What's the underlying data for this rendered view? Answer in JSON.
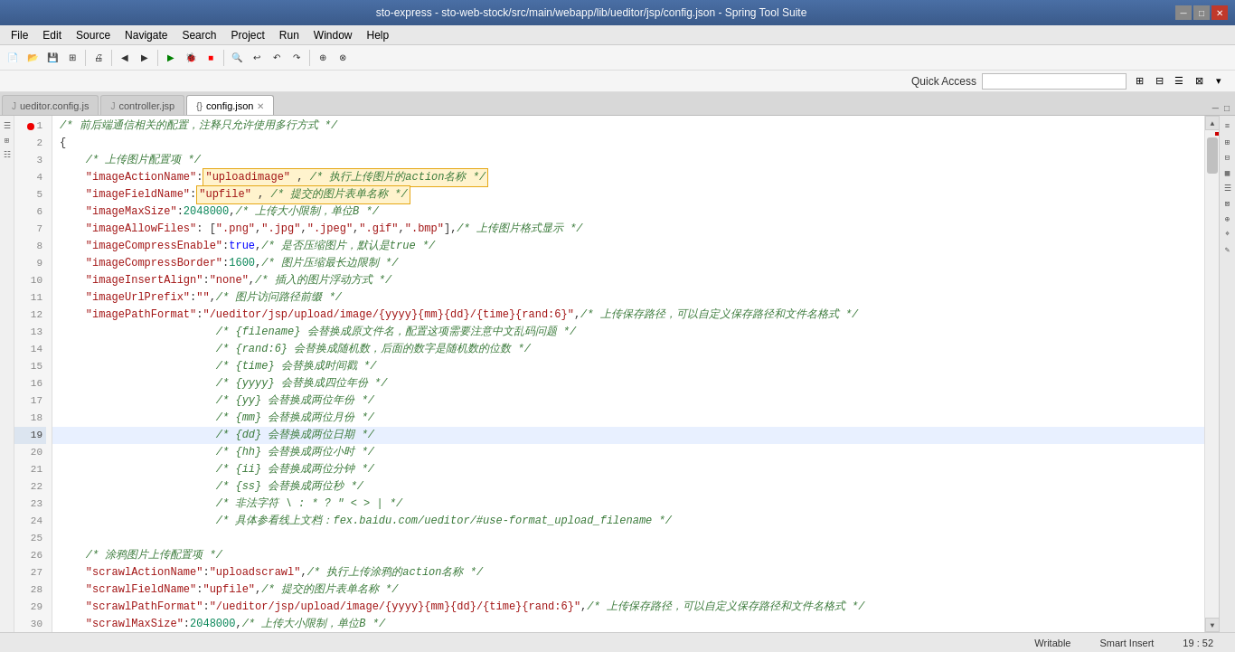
{
  "titleBar": {
    "title": "sto-express - sto-web-stock/src/main/webapp/lib/ueditor/jsp/config.json - Spring Tool Suite",
    "minimizeBtn": "─",
    "maximizeBtn": "□",
    "closeBtn": "✕"
  },
  "menuBar": {
    "items": [
      "File",
      "Edit",
      "Source",
      "Navigate",
      "Search",
      "Project",
      "Run",
      "Window",
      "Help"
    ]
  },
  "quickAccess": {
    "label": "Quick Access"
  },
  "tabs": [
    {
      "id": "tab1",
      "icon": "J",
      "label": "ueditor.config.js",
      "active": false,
      "closable": false
    },
    {
      "id": "tab2",
      "icon": "J",
      "label": "controller.jsp",
      "active": false,
      "closable": false
    },
    {
      "id": "tab3",
      "icon": "{}",
      "label": "config.json",
      "active": true,
      "closable": true
    }
  ],
  "codeLines": [
    {
      "num": 1,
      "hasError": true,
      "content": "/* 前后端通信相关的配置，注释只允许使用多行方式 */",
      "type": "comment",
      "highlighted": false
    },
    {
      "num": 2,
      "content": "{",
      "highlighted": false
    },
    {
      "num": 3,
      "content": "    /* 上传图片配置项 */",
      "type": "comment",
      "highlighted": false
    },
    {
      "num": 4,
      "content": "    \"imageActionName\": \"uploadimage\",  /* 执行上传图片的action名称 */",
      "highlighted": false,
      "hasHighlightBox": true,
      "boxStart": 22,
      "special": "line4"
    },
    {
      "num": 5,
      "content": "    \"imageFieldName\": \"upfile\",  /* 提交的图片表单名称 */",
      "highlighted": false,
      "special": "line5"
    },
    {
      "num": 6,
      "content": "    \"imageMaxSize\": 2048000,  /* 上传大小限制，单位B */",
      "highlighted": false
    },
    {
      "num": 7,
      "content": "    \"imageAllowFiles\": [\".png\", \".jpg\", \".jpeg\", \".gif\", \".bmp\"],  /* 上传图片格式显示 */",
      "highlighted": false
    },
    {
      "num": 8,
      "content": "    \"imageCompressEnable\": true,  /* 是否压缩图片，默认是true */",
      "highlighted": false
    },
    {
      "num": 9,
      "content": "    \"imageCompressBorder\": 1600,  /* 图片压缩最长边限制 */",
      "highlighted": false
    },
    {
      "num": 10,
      "content": "    \"imageInsertAlign\": \"none\",  /* 插入的图片浮动方式 */",
      "highlighted": false
    },
    {
      "num": 11,
      "content": "    \"imageUrlPrefix\": \"\",  /* 图片访问路径前缀 */",
      "highlighted": false
    },
    {
      "num": 12,
      "content": "    \"imagePathFormat\": \"/ueditor/jsp/upload/image/{yyyy}{mm}{dd}/{time}{rand:6}\",  /* 上传保存路径，可以自定义保存路径和文件名格式 */",
      "highlighted": false
    },
    {
      "num": 13,
      "content": "                        /* {filename} 会替换成原文件名，配置这项需要注意中文乱码问题 */",
      "type": "comment",
      "highlighted": false
    },
    {
      "num": 14,
      "content": "                        /* {rand:6} 会替换成随机数，后面的数字是随机数的位数 */",
      "type": "comment",
      "highlighted": false
    },
    {
      "num": 15,
      "content": "                        /* {time} 会替换成时间戳 */",
      "type": "comment",
      "highlighted": false
    },
    {
      "num": 16,
      "content": "                        /* {yyyy} 会替换成四位年份 */",
      "type": "comment",
      "highlighted": false
    },
    {
      "num": 17,
      "content": "                        /* {yy} 会替换成两位年份 */",
      "type": "comment",
      "highlighted": false
    },
    {
      "num": 18,
      "content": "                        /* {mm} 会替换成两位月份 */",
      "type": "comment",
      "highlighted": false
    },
    {
      "num": 19,
      "content": "                        /* {dd} 会替换成两位日期 */",
      "type": "comment",
      "highlighted": true
    },
    {
      "num": 20,
      "content": "                        /* {hh} 会替换成两位小时 */",
      "type": "comment",
      "highlighted": false
    },
    {
      "num": 21,
      "content": "                        /* {ii} 会替换成两位分钟 */",
      "type": "comment",
      "highlighted": false
    },
    {
      "num": 22,
      "content": "                        /* {ss} 会替换成两位秒 */",
      "type": "comment",
      "highlighted": false
    },
    {
      "num": 23,
      "content": "                        /* 非法字符 \\ : * ? \" < > | */",
      "type": "comment",
      "highlighted": false
    },
    {
      "num": 24,
      "content": "                        /* 具体参看线上文档：fex.baidu.com/ueditor/#use-format_upload_filename */",
      "type": "comment",
      "highlighted": false
    },
    {
      "num": 25,
      "content": "",
      "highlighted": false
    },
    {
      "num": 26,
      "content": "    /* 涂鸦图片上传配置项 */",
      "type": "comment",
      "highlighted": false
    },
    {
      "num": 27,
      "content": "    \"scrawlActionName\": \"uploadscrawl\",  /* 执行上传涂鸦的action名称 */",
      "highlighted": false
    },
    {
      "num": 28,
      "content": "    \"scrawlFieldName\": \"upfile\",  /* 提交的图片表单名称 */",
      "highlighted": false
    },
    {
      "num": 29,
      "content": "    \"scrawlPathFormat\": \"/ueditor/jsp/upload/image/{yyyy}{mm}{dd}/{time}{rand:6}\",  /* 上传保存路径，可以自定义保存路径和文件名格式 */",
      "highlighted": false
    },
    {
      "num": 30,
      "content": "    \"scrawlMaxSize\": 2048000,  /* 上传大小限制，单位B */",
      "highlighted": false
    }
  ],
  "statusBar": {
    "writable": "Writable",
    "smartInsert": "Smart Insert",
    "position": "19 : 52",
    "extras": ""
  },
  "colors": {
    "accent": "#3a5a8a",
    "errorRed": "#cc0000",
    "highlightLine": "#dce5f0",
    "commentGreen": "#3a7a3a",
    "stringRed": "#a31515",
    "keyBlue": "#0000aa"
  }
}
